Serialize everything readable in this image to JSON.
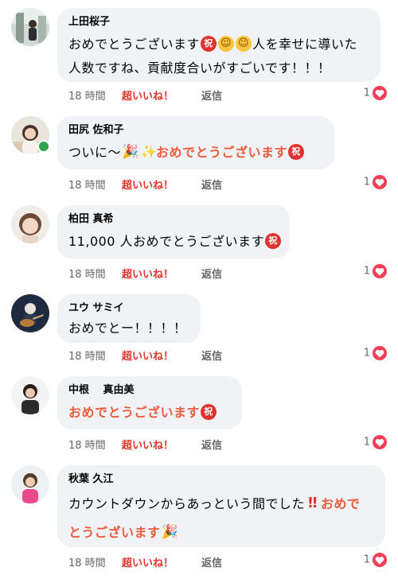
{
  "comments": [
    {
      "author": "上田桜子",
      "lines": [
        [
          {
            "t": "おめでとうございます"
          },
          {
            "emoji": "祝"
          },
          {
            "smile": "☺"
          },
          {
            "smile": "☺"
          },
          {
            "t": "人を幸せに導いた"
          }
        ],
        [
          {
            "t": "人数ですね、貢献度合いがすごいです！！！"
          }
        ]
      ],
      "time": "18 時間",
      "like_label": "超いいね！",
      "reply_label": "返信",
      "reaction_count": "1"
    },
    {
      "author": "田尻 佐和子",
      "lines": [
        [
          {
            "t": "ついに〜"
          },
          {
            "party": "🎉"
          },
          {
            "sparkle": "✨"
          },
          {
            "accent": "おめでとうございます"
          },
          {
            "emoji": "祝"
          }
        ]
      ],
      "time": "18 時間",
      "like_label": "超いいね！",
      "reply_label": "返信",
      "reaction_count": "1"
    },
    {
      "author": "柏田 真希",
      "lines": [
        [
          {
            "t": "11,000 人おめでとうございます"
          },
          {
            "emoji": "祝"
          }
        ]
      ],
      "time": "18 時間",
      "like_label": "超いいね！",
      "reply_label": "返信",
      "reaction_count": "1"
    },
    {
      "author": "ユウ サミイ",
      "lines": [
        [
          {
            "t": "おめでとー！！！！"
          }
        ]
      ],
      "time": "18 時間",
      "like_label": "超いいね！",
      "reply_label": "返信",
      "reaction_count": "1"
    },
    {
      "author": "中根　 真由美",
      "lines": [
        [
          {
            "accent": "おめでとうございます"
          },
          {
            "emoji": "祝"
          }
        ]
      ],
      "time": "18 時間",
      "like_label": "超いいね！",
      "reply_label": "返信",
      "reaction_count": "1"
    },
    {
      "author": "秋葉 久江",
      "lines": [
        [
          {
            "t": "カウントダウンからあっという間でした"
          },
          {
            "bang": "‼"
          },
          {
            "accent": "おめで"
          }
        ],
        [
          {
            "accent": "とうございます"
          },
          {
            "party": "🎉"
          }
        ]
      ],
      "time": "18 時間",
      "like_label": "超いいね！",
      "reply_label": "返信",
      "reaction_count": "1"
    }
  ]
}
